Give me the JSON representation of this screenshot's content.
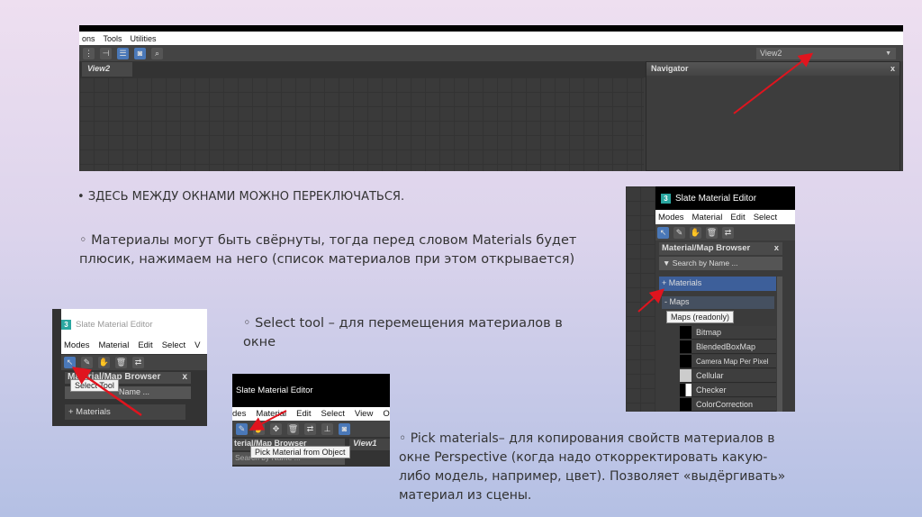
{
  "shot1": {
    "menu": [
      "ons",
      "Tools",
      "Utilities"
    ],
    "tab": "View2",
    "dropdown": "View2",
    "panel_title": "Navigator",
    "close": "x"
  },
  "bullet1": "ЗДЕСЬ МЕЖДУ ОКНАМИ МОЖНО ПЕРЕКЛЮЧАТЬСЯ.",
  "bullet2": "Материалы могут быть свёрнуты, тогда перед словом  Materials будет плюсик, нажимаем на него (список материалов при этом открывается)",
  "bullet3": "Select tool – для перемещения материалов в окне",
  "bullet4": "Pick materials– для копирования свойств материалов в окне Perspective (когда надо откорректировать какую-либо модель, например, цвет). Позволяет «выдёргивать» материал из сцены.",
  "marker": "◦",
  "marker_filled": "•",
  "shot2": {
    "title": "Slate Material Editor",
    "logo": "3",
    "menu": [
      "Modes",
      "Material",
      "Edit",
      "Select"
    ],
    "browser": "Material/Map Browser",
    "close": "x",
    "search": "Search by Name ...",
    "materials": "+ Materials",
    "maps": "- Maps",
    "tooltip": "Maps (readonly)",
    "items": [
      "Bitmap",
      "BlendedBoxMap",
      "Camera Map Per Pixel",
      "Cellular",
      "Checker",
      "ColorCorrection"
    ]
  },
  "shot3": {
    "title": "Slate Material Editor",
    "logo": "3",
    "menu": [
      "Modes",
      "Material",
      "Edit",
      "Select",
      "V"
    ],
    "browser": "Material/Map Browser",
    "close": "x",
    "search": "Name ...",
    "tooltip": "Select Tool",
    "materials": "+ Materials"
  },
  "shot4": {
    "title": "Slate Material Editor",
    "menu": [
      "des",
      "Material",
      "Edit",
      "Select",
      "View",
      "O"
    ],
    "browser": "terial/Map Browser",
    "view": "View1",
    "search": "Search by Name ...",
    "tooltip": "Pick Material from Object"
  },
  "colors": {
    "arrow": "#e0141e",
    "accent": "#4a78b8"
  }
}
